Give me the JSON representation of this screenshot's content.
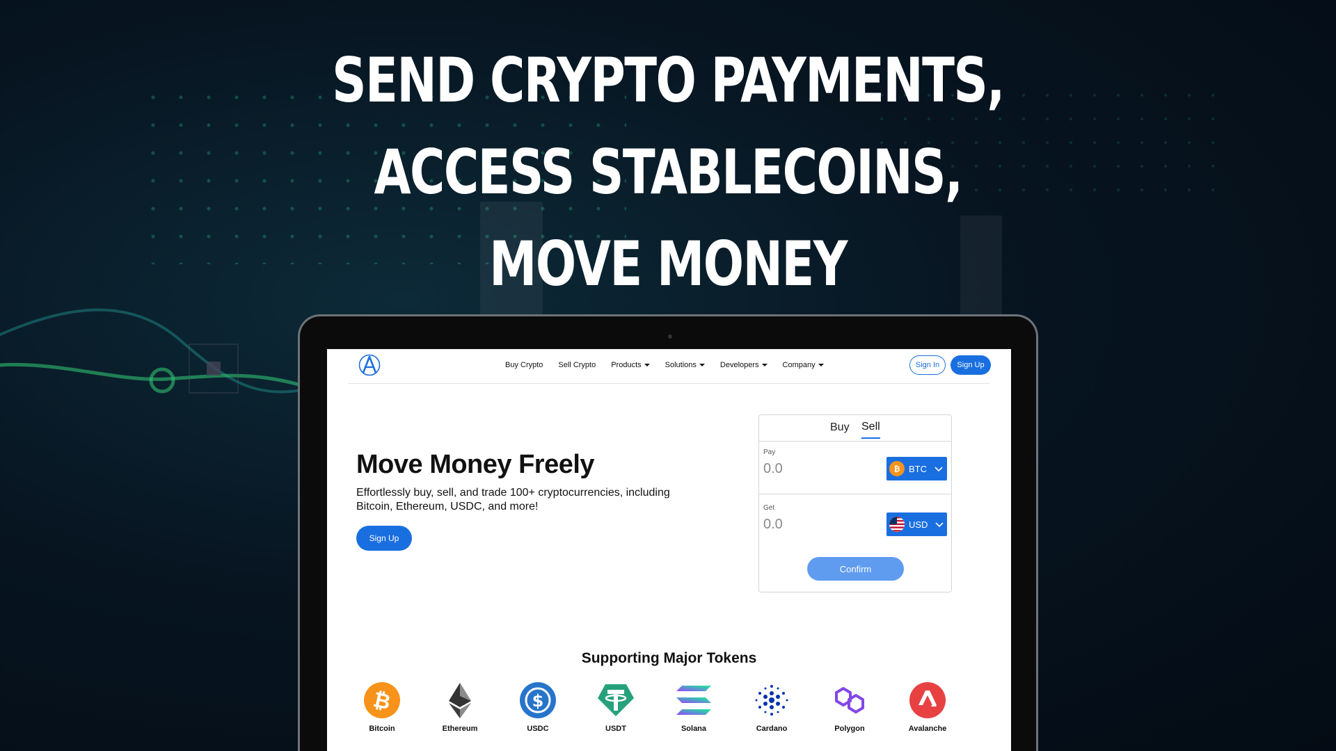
{
  "headline": {
    "line1": "SEND CRYPTO PAYMENTS,",
    "line2": "ACCESS STABLECOINS,",
    "line3": "MOVE MONEY"
  },
  "nav": {
    "links": [
      "Buy Crypto",
      "Sell Crypto",
      "Products",
      "Solutions",
      "Developers",
      "Company"
    ],
    "sign_in": "Sign In",
    "sign_up": "Sign Up"
  },
  "hero": {
    "title": "Move Money Freely",
    "subtitle": "Effortlessly buy, sell, and trade 100+ cryptocurrencies, including Bitcoin, Ethereum, USDC, and more!",
    "cta": "Sign Up"
  },
  "widget": {
    "tabs": [
      "Buy",
      "Sell"
    ],
    "active_tab": "Sell",
    "pay_label": "Pay",
    "pay_value": "0.0",
    "pay_currency": "BTC",
    "get_label": "Get",
    "get_value": "0.0",
    "get_currency": "USD",
    "confirm": "Confirm"
  },
  "tokens": {
    "title": "Supporting Major Tokens",
    "items": [
      {
        "name": "Bitcoin",
        "icon": "bitcoin-icon",
        "color": "#F7931A"
      },
      {
        "name": "Ethereum",
        "icon": "ethereum-icon",
        "color": "#343434"
      },
      {
        "name": "USDC",
        "icon": "usdc-icon",
        "color": "#2775CA"
      },
      {
        "name": "USDT",
        "icon": "usdt-icon",
        "color": "#26A17B"
      },
      {
        "name": "Solana",
        "icon": "solana-icon",
        "color": "#9945FF"
      },
      {
        "name": "Cardano",
        "icon": "cardano-icon",
        "color": "#0033AD"
      },
      {
        "name": "Polygon",
        "icon": "polygon-icon",
        "color": "#8247E5"
      },
      {
        "name": "Avalanche",
        "icon": "avalanche-icon",
        "color": "#E84142"
      }
    ]
  },
  "colors": {
    "accent": "#1a6fe0",
    "confirm": "#5f9cf0"
  }
}
